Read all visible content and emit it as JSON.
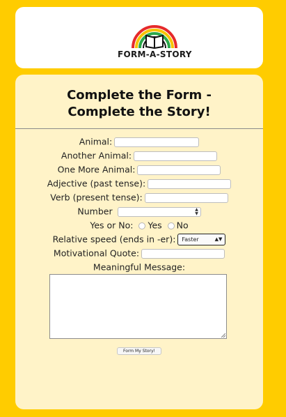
{
  "header": {
    "logo_text": "FORM-A-STORY",
    "logo_icon": "rainbow-book-icon"
  },
  "form": {
    "title_line1": "Complete the Form -",
    "title_line2": "Complete the Story!",
    "fields": {
      "animal": {
        "label": "Animal:",
        "value": ""
      },
      "another_animal": {
        "label": "Another Animal:",
        "value": ""
      },
      "one_more_animal": {
        "label": "One More Animal:",
        "value": ""
      },
      "adjective": {
        "label": "Adjective (past tense):",
        "value": ""
      },
      "verb": {
        "label": "Verb (present tense):",
        "value": ""
      },
      "number": {
        "label": "Number",
        "value": ""
      },
      "yes_or_no": {
        "label": "Yes or No:",
        "option_yes": "Yes",
        "option_no": "No"
      },
      "relative_speed": {
        "label": "Relative speed (ends in -er):",
        "selected": "Faster"
      },
      "quote": {
        "label": "Motivational Quote:",
        "value": ""
      },
      "message": {
        "label": "Meaningful Message:",
        "value": ""
      }
    },
    "submit_label": "Form My Story!"
  },
  "colors": {
    "page_background": "#ffcc00",
    "card_background": "#fff3c8",
    "header_background": "#ffffff"
  }
}
